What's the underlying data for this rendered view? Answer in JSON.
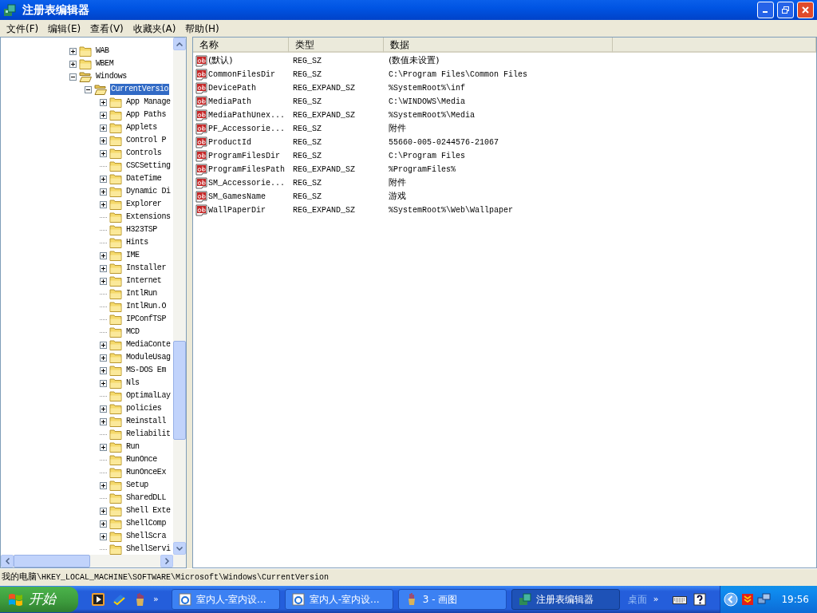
{
  "window": {
    "title": "注册表编辑器"
  },
  "menu": [
    "文件(F)",
    "编辑(E)",
    "查看(V)",
    "收藏夹(A)",
    "帮助(H)"
  ],
  "tree": [
    {
      "label": "WAB",
      "expandable": true,
      "expanded": false,
      "selected": false
    },
    {
      "label": "WBEM",
      "expandable": true,
      "expanded": false,
      "selected": false
    },
    {
      "label": "Windows",
      "expandable": true,
      "expanded": true,
      "selected": false,
      "children": [
        {
          "label": "CurrentVersio",
          "expandable": true,
          "expanded": true,
          "selected": true,
          "children": [
            {
              "label": "App Manage",
              "expandable": true,
              "expanded": false,
              "selected": false
            },
            {
              "label": "App Paths",
              "expandable": true,
              "expanded": false,
              "selected": false
            },
            {
              "label": "Applets",
              "expandable": true,
              "expanded": false,
              "selected": false
            },
            {
              "label": "Control P",
              "expandable": true,
              "expanded": false,
              "selected": false
            },
            {
              "label": "Controls",
              "expandable": true,
              "expanded": false,
              "selected": false
            },
            {
              "label": "CSCSetting",
              "expandable": false,
              "expanded": false,
              "selected": false
            },
            {
              "label": "DateTime",
              "expandable": true,
              "expanded": false,
              "selected": false
            },
            {
              "label": "Dynamic Di",
              "expandable": true,
              "expanded": false,
              "selected": false
            },
            {
              "label": "Explorer",
              "expandable": true,
              "expanded": false,
              "selected": false
            },
            {
              "label": "Extensions",
              "expandable": false,
              "expanded": false,
              "selected": false
            },
            {
              "label": "H323TSP",
              "expandable": false,
              "expanded": false,
              "selected": false
            },
            {
              "label": "Hints",
              "expandable": false,
              "expanded": false,
              "selected": false
            },
            {
              "label": "IME",
              "expandable": true,
              "expanded": false,
              "selected": false
            },
            {
              "label": "Installer",
              "expandable": true,
              "expanded": false,
              "selected": false
            },
            {
              "label": "Internet",
              "expandable": true,
              "expanded": false,
              "selected": false
            },
            {
              "label": "IntlRun",
              "expandable": false,
              "expanded": false,
              "selected": false
            },
            {
              "label": "IntlRun.O",
              "expandable": false,
              "expanded": false,
              "selected": false
            },
            {
              "label": "IPConfTSP",
              "expandable": false,
              "expanded": false,
              "selected": false
            },
            {
              "label": "MCD",
              "expandable": false,
              "expanded": false,
              "selected": false
            },
            {
              "label": "MediaConte",
              "expandable": true,
              "expanded": false,
              "selected": false
            },
            {
              "label": "ModuleUsag",
              "expandable": true,
              "expanded": false,
              "selected": false
            },
            {
              "label": "MS-DOS Em",
              "expandable": true,
              "expanded": false,
              "selected": false
            },
            {
              "label": "Nls",
              "expandable": true,
              "expanded": false,
              "selected": false
            },
            {
              "label": "OptimalLay",
              "expandable": false,
              "expanded": false,
              "selected": false
            },
            {
              "label": "policies",
              "expandable": true,
              "expanded": false,
              "selected": false
            },
            {
              "label": "Reinstall",
              "expandable": true,
              "expanded": false,
              "selected": false
            },
            {
              "label": "Reliabilit",
              "expandable": false,
              "expanded": false,
              "selected": false
            },
            {
              "label": "Run",
              "expandable": true,
              "expanded": false,
              "selected": false
            },
            {
              "label": "RunOnce",
              "expandable": false,
              "expanded": false,
              "selected": false
            },
            {
              "label": "RunOnceEx",
              "expandable": false,
              "expanded": false,
              "selected": false
            },
            {
              "label": "Setup",
              "expandable": true,
              "expanded": false,
              "selected": false
            },
            {
              "label": "SharedDLL",
              "expandable": false,
              "expanded": false,
              "selected": false
            },
            {
              "label": "Shell Exte",
              "expandable": true,
              "expanded": false,
              "selected": false
            },
            {
              "label": "ShellComp",
              "expandable": true,
              "expanded": false,
              "selected": false
            },
            {
              "label": "ShellScra",
              "expandable": true,
              "expanded": false,
              "selected": false
            },
            {
              "label": "ShellServi",
              "expandable": false,
              "expanded": false,
              "selected": false
            }
          ]
        }
      ]
    }
  ],
  "list": {
    "columns": [
      "名称",
      "类型",
      "数据"
    ],
    "rows": [
      {
        "name": "(默认)",
        "type": "REG_SZ",
        "data": "(数值未设置)"
      },
      {
        "name": "CommonFilesDir",
        "type": "REG_SZ",
        "data": "C:\\Program Files\\Common Files"
      },
      {
        "name": "DevicePath",
        "type": "REG_EXPAND_SZ",
        "data": "%SystemRoot%\\inf"
      },
      {
        "name": "MediaPath",
        "type": "REG_SZ",
        "data": "C:\\WINDOWS\\Media"
      },
      {
        "name": "MediaPathUnex...",
        "type": "REG_EXPAND_SZ",
        "data": "%SystemRoot%\\Media"
      },
      {
        "name": "PF_Accessorie...",
        "type": "REG_SZ",
        "data": "附件"
      },
      {
        "name": "ProductId",
        "type": "REG_SZ",
        "data": "55660-005-0244576-21067"
      },
      {
        "name": "ProgramFilesDir",
        "type": "REG_SZ",
        "data": "C:\\Program Files"
      },
      {
        "name": "ProgramFilesPath",
        "type": "REG_EXPAND_SZ",
        "data": "%ProgramFiles%"
      },
      {
        "name": "SM_Accessorie...",
        "type": "REG_SZ",
        "data": "附件"
      },
      {
        "name": "SM_GamesName",
        "type": "REG_SZ",
        "data": "游戏"
      },
      {
        "name": "WallPaperDir",
        "type": "REG_EXPAND_SZ",
        "data": "%SystemRoot%\\Web\\Wallpaper"
      }
    ]
  },
  "status_bar": "我的电脑\\HKEY_LOCAL_MACHINE\\SOFTWARE\\Microsoft\\Windows\\CurrentVersion",
  "taskbar": {
    "start": "开始",
    "quick_launch_more": "»",
    "tasks": [
      {
        "label": "室内人-室内设...",
        "kind": "browser",
        "selected": false
      },
      {
        "label": "室内人-室内设...",
        "kind": "browser",
        "selected": false
      },
      {
        "label": "3 - 画图",
        "kind": "paint",
        "selected": false
      },
      {
        "label": "注册表编辑器",
        "kind": "registry",
        "selected": true
      }
    ],
    "toolbar": "桌面",
    "toolbar_more": "»",
    "clock": "19:56"
  }
}
